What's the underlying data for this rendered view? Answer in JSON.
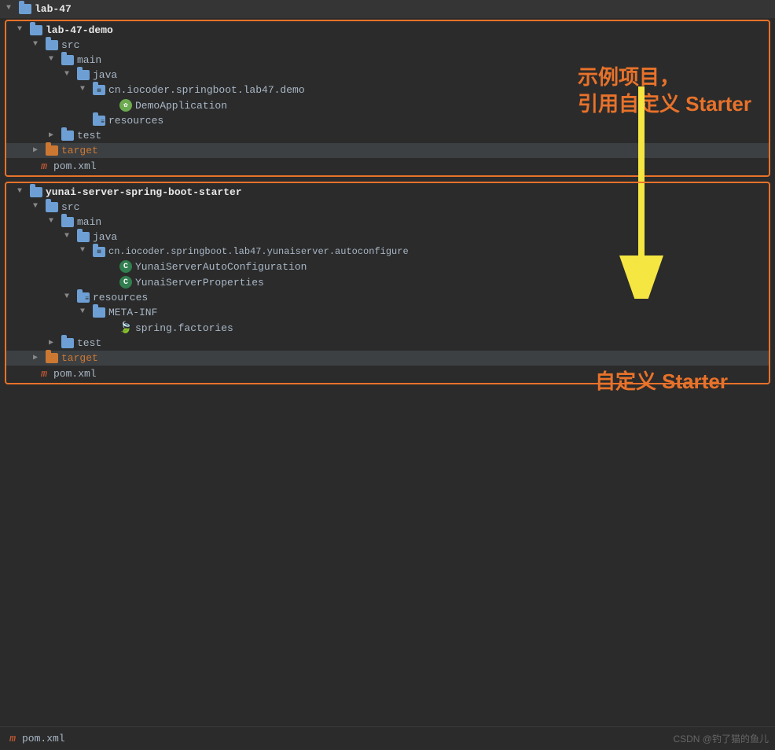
{
  "root": {
    "label": "lab-47"
  },
  "demo_box": {
    "annotation": "示例项目，\n引用自定义 Starter",
    "items": [
      {
        "id": "lab47demo",
        "label": "lab-47-demo",
        "type": "project-folder",
        "indent": 0,
        "arrow": "down",
        "bold": true
      },
      {
        "id": "src1",
        "label": "src",
        "type": "folder",
        "indent": 1,
        "arrow": "down"
      },
      {
        "id": "main1",
        "label": "main",
        "type": "folder",
        "indent": 2,
        "arrow": "down"
      },
      {
        "id": "java1",
        "label": "java",
        "type": "folder",
        "indent": 3,
        "arrow": "down"
      },
      {
        "id": "pkg1",
        "label": "cn.iocoder.springboot.lab47.demo",
        "type": "package",
        "indent": 4,
        "arrow": "down"
      },
      {
        "id": "demo-app",
        "label": "DemoApplication",
        "type": "spring-class",
        "indent": 5,
        "arrow": "none"
      },
      {
        "id": "res1",
        "label": "resources",
        "type": "resources-folder",
        "indent": 4,
        "arrow": "none"
      },
      {
        "id": "test1",
        "label": "test",
        "type": "folder",
        "indent": 2,
        "arrow": "right"
      },
      {
        "id": "target1",
        "label": "target",
        "type": "folder-orange",
        "indent": 1,
        "arrow": "right",
        "orange": true
      }
    ],
    "pom": {
      "label": "pom.xml",
      "type": "maven"
    }
  },
  "starter_box": {
    "annotation": "自定义 Starter",
    "items": [
      {
        "id": "starter",
        "label": "yunai-server-spring-boot-starter",
        "type": "project-folder",
        "indent": 0,
        "arrow": "down",
        "bold": true
      },
      {
        "id": "src2",
        "label": "src",
        "type": "folder",
        "indent": 1,
        "arrow": "down"
      },
      {
        "id": "main2",
        "label": "main",
        "type": "folder",
        "indent": 2,
        "arrow": "down"
      },
      {
        "id": "java2",
        "label": "java",
        "type": "folder",
        "indent": 3,
        "arrow": "down"
      },
      {
        "id": "pkg2",
        "label": "cn.iocoder.springboot.lab47.yunaiserver.autoconfigure",
        "type": "package",
        "indent": 4,
        "arrow": "down"
      },
      {
        "id": "auto-config",
        "label": "YunaiServerAutoConfiguration",
        "type": "class",
        "indent": 5,
        "arrow": "none"
      },
      {
        "id": "props",
        "label": "YunaiServerProperties",
        "type": "class",
        "indent": 5,
        "arrow": "none"
      },
      {
        "id": "res2",
        "label": "resources",
        "type": "resources-folder",
        "indent": 3,
        "arrow": "down"
      },
      {
        "id": "meta-inf",
        "label": "META-INF",
        "type": "folder",
        "indent": 4,
        "arrow": "down"
      },
      {
        "id": "spring-factories",
        "label": "spring.factories",
        "type": "spring-file",
        "indent": 5,
        "arrow": "none"
      },
      {
        "id": "test2",
        "label": "test",
        "type": "folder",
        "indent": 2,
        "arrow": "right"
      },
      {
        "id": "target2",
        "label": "target",
        "type": "folder-orange",
        "indent": 1,
        "arrow": "right",
        "orange": true
      }
    ],
    "pom": {
      "label": "pom.xml",
      "type": "maven"
    }
  },
  "footer": {
    "pom_label": "pom.xml",
    "watermark": "CSDN @钓了猫的鱼儿"
  }
}
